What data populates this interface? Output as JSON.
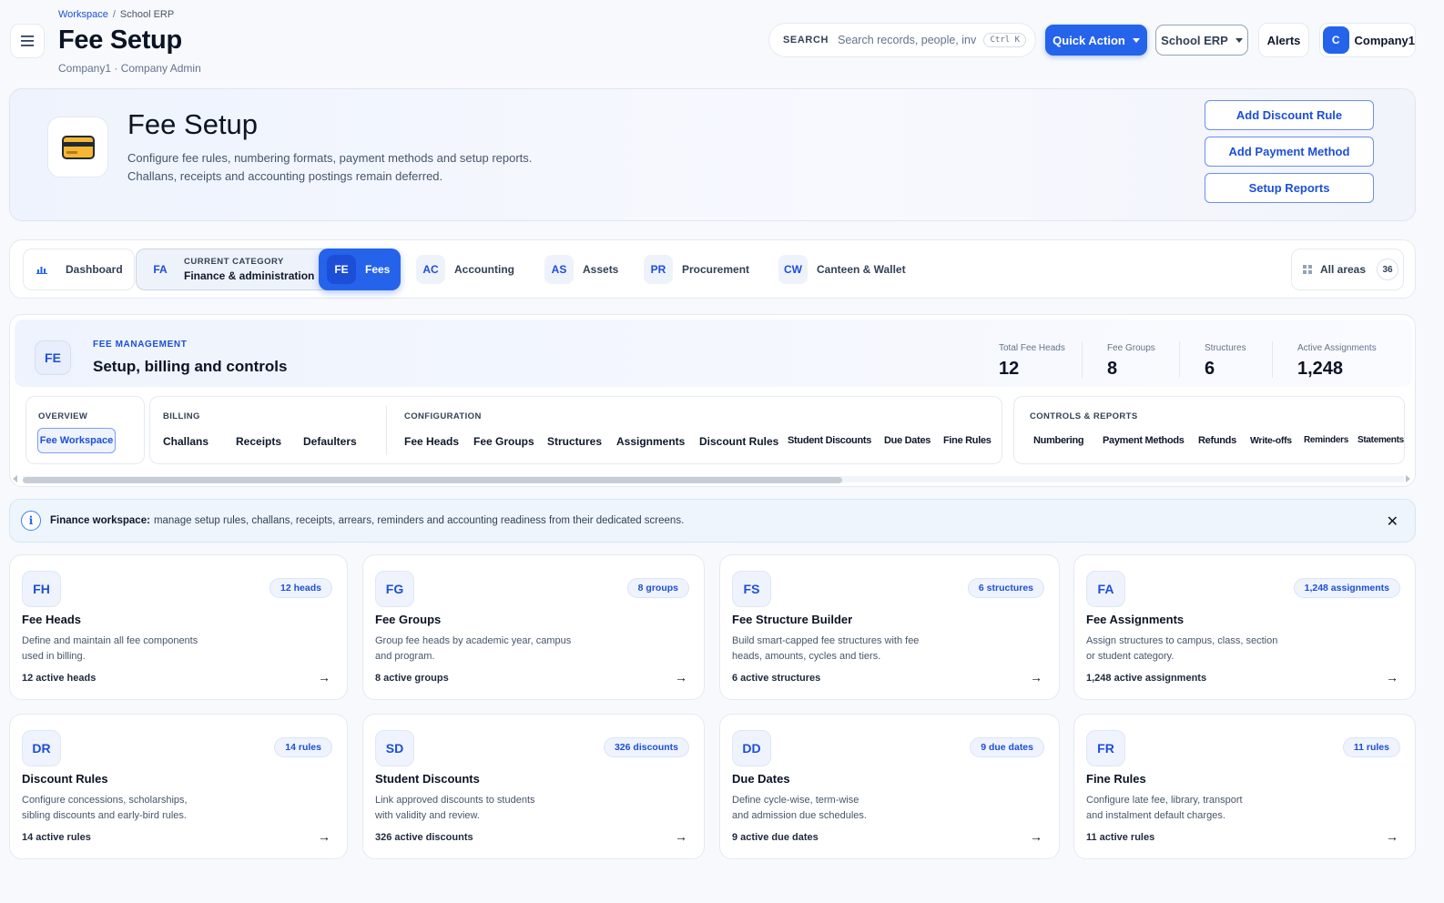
{
  "header": {
    "breadcrumb_workspace": "Workspace",
    "breadcrumb_sep": "/",
    "breadcrumb_current": "School ERP",
    "title": "Fee Setup",
    "subtitle": "Company1 · Company Admin",
    "search_label": "SEARCH",
    "search_placeholder": "Search records, people, invc",
    "search_shortcut": "Ctrl K",
    "quick_action": "Quick Action",
    "module_select": "School ERP",
    "alerts": "Alerts",
    "avatar_initial": "C",
    "company": "Company1"
  },
  "hero": {
    "title": "Fee Setup",
    "desc_line1": "Configure fee rules, numbering formats, payment methods and setup reports.",
    "desc_line2": "Challans, receipts and accounting postings remain deferred.",
    "actions": [
      "Add Discount Rule",
      "Add Payment Method",
      "Setup Reports"
    ]
  },
  "categories": {
    "dashboard": "Dashboard",
    "current_tag": "FA",
    "current_caption": "CURRENT CATEGORY",
    "current_name": "Finance & administration",
    "items": [
      {
        "tag": "FE",
        "label": "Fees"
      },
      {
        "tag": "AC",
        "label": "Accounting"
      },
      {
        "tag": "AS",
        "label": "Assets"
      },
      {
        "tag": "PR",
        "label": "Procurement"
      },
      {
        "tag": "CW",
        "label": "Canteen & Wallet"
      }
    ],
    "all_areas": "All areas",
    "all_count": "36"
  },
  "fee_mgmt": {
    "badge": "FE",
    "eyebrow": "FEE MANAGEMENT",
    "title": "Setup, billing and controls",
    "stats": [
      {
        "label": "Total Fee Heads",
        "value": "12"
      },
      {
        "label": "Fee Groups",
        "value": "8"
      },
      {
        "label": "Structures",
        "value": "6"
      },
      {
        "label": "Active Assignments",
        "value": "1,248"
      }
    ],
    "overview_header": "OVERVIEW",
    "overview_button": "Fee Workspace",
    "billing_header": "BILLING",
    "billing": [
      "Challans",
      "Receipts",
      "Defaulters"
    ],
    "config_header": "CONFIGURATION",
    "config": [
      "Fee Heads",
      "Fee Groups",
      "Structures",
      "Assignments",
      "Discount Rules",
      "Student Discounts",
      "Due Dates",
      "Fine Rules"
    ],
    "controls_header": "CONTROLS & REPORTS",
    "controls": [
      "Numbering",
      "Payment Methods",
      "Refunds",
      "Write-offs",
      "Reminders",
      "Statements"
    ]
  },
  "info": {
    "lead": "Finance workspace:",
    "text": "manage setup rules, challans, receipts, arrears, reminders and accounting readiness from their dedicated screens.",
    "close": "✕"
  },
  "cards": [
    {
      "code": "FH",
      "pill": "12 heads",
      "title": "Fee Heads",
      "desc1": "Define and maintain all fee components",
      "desc2": "used in billing.",
      "foot": "12 active heads"
    },
    {
      "code": "FG",
      "pill": "8 groups",
      "title": "Fee Groups",
      "desc1": "Group fee heads by academic year, campus",
      "desc2": "and program.",
      "foot": "8 active groups"
    },
    {
      "code": "FS",
      "pill": "6 structures",
      "title": "Fee Structure Builder",
      "desc1": "Build smart-capped fee structures with fee",
      "desc2": "heads, amounts, cycles and tiers.",
      "foot": "6 active structures"
    },
    {
      "code": "FA",
      "pill": "1,248 assignments",
      "title": "Fee Assignments",
      "desc1": "Assign structures to campus, class, section",
      "desc2": "or student category.",
      "foot": "1,248 active assignments"
    },
    {
      "code": "DR",
      "pill": "14 rules",
      "title": "Discount Rules",
      "desc1": "Configure concessions, scholarships,",
      "desc2": "sibling discounts and early-bird rules.",
      "foot": "14 active rules"
    },
    {
      "code": "SD",
      "pill": "326 discounts",
      "title": "Student Discounts",
      "desc1": "Link approved discounts to students",
      "desc2": "with validity and review.",
      "foot": "326 active discounts"
    },
    {
      "code": "DD",
      "pill": "9 due dates",
      "title": "Due Dates",
      "desc1": "Define cycle-wise, term-wise",
      "desc2": "and admission due schedules.",
      "foot": "9 active due dates"
    },
    {
      "code": "FR",
      "pill": "11 rules",
      "title": "Fine Rules",
      "desc1": "Configure late fee, library, transport",
      "desc2": "and instalment default charges.",
      "foot": "11 active rules"
    }
  ],
  "arrow": "→",
  "colors": {
    "accent": "#2563eb",
    "accent_dark": "#1d4ed8",
    "text": "#0b1324",
    "muted": "#64748b"
  }
}
